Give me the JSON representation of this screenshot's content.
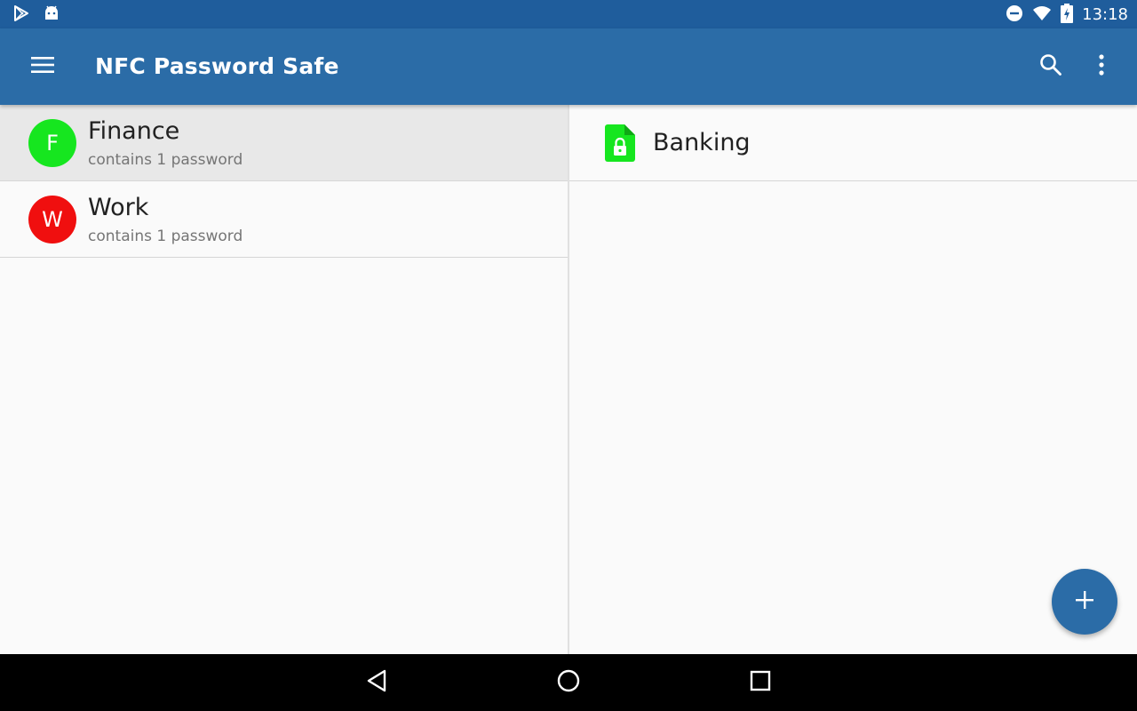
{
  "app": {
    "title": "NFC Password Safe",
    "accent_color": "#2b6ca7",
    "status_bar_color": "#1f5d9c"
  },
  "status_bar": {
    "time": "13:18",
    "left_icons": [
      "play-store-icon",
      "android-icon"
    ],
    "right_icons": [
      "do-not-disturb-icon",
      "wifi-icon",
      "battery-charging-icon"
    ]
  },
  "toolbar": {
    "menu_icon": "hamburger-menu-icon",
    "search_icon": "search-icon",
    "overflow_icon": "more-vert-icon"
  },
  "categories": [
    {
      "letter": "F",
      "name": "Finance",
      "subtitle": "contains 1 password",
      "color": "#16e61f",
      "selected": true
    },
    {
      "letter": "W",
      "name": "Work",
      "subtitle": "contains 1 password",
      "color": "#f00f0f",
      "selected": false
    }
  ],
  "entries": [
    {
      "title": "Banking",
      "icon": "locked-file-icon",
      "color": "#16e61f"
    }
  ],
  "fab": {
    "icon": "plus-icon"
  },
  "nav": {
    "back_icon": "back-triangle-icon",
    "home_icon": "home-circle-icon",
    "recents_icon": "recents-square-icon"
  }
}
